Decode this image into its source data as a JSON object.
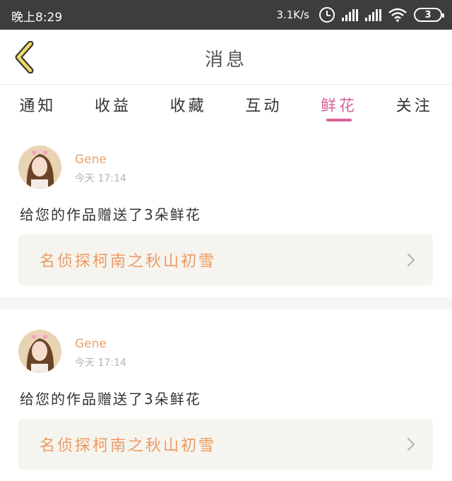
{
  "status_bar": {
    "time": "晚上8:29",
    "net_speed": "3.1K/s",
    "battery": "3"
  },
  "header": {
    "title": "消息"
  },
  "tabs": [
    {
      "label": "通知",
      "active": false
    },
    {
      "label": "收益",
      "active": false
    },
    {
      "label": "收藏",
      "active": false
    },
    {
      "label": "互动",
      "active": false
    },
    {
      "label": "鲜花",
      "active": true
    },
    {
      "label": "关注",
      "active": false
    }
  ],
  "messages": [
    {
      "sender": "Gene",
      "time": "今天 17:14",
      "text": "给您的作品赠送了3朵鲜花",
      "work_title": "名侦探柯南之秋山初雪"
    },
    {
      "sender": "Gene",
      "time": "今天 17:14",
      "text": "给您的作品赠送了3朵鲜花",
      "work_title": "名侦探柯南之秋山初雪"
    }
  ],
  "colors": {
    "accent_pink": "#d9639a",
    "sender_orange": "#e8a06a",
    "work_title_orange": "#ec9a63",
    "back_arrow_yellow": "#f2dc63"
  }
}
